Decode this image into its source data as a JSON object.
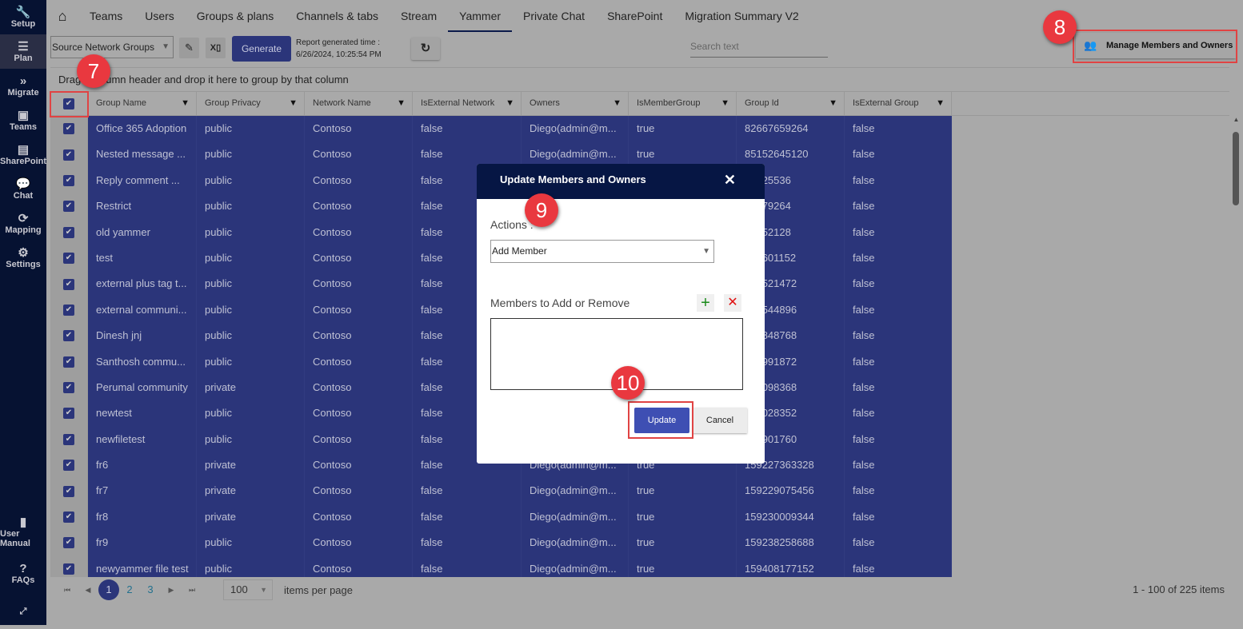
{
  "sidebar": {
    "items": [
      {
        "label": "Setup",
        "icon": "wrench-icon",
        "glyph": "🔧"
      },
      {
        "label": "Plan",
        "icon": "list-icon",
        "glyph": "☰",
        "active": true
      },
      {
        "label": "Migrate",
        "icon": "double-chevron-icon",
        "glyph": "»"
      },
      {
        "label": "Teams",
        "icon": "teams-icon",
        "glyph": "▣"
      },
      {
        "label": "SharePoint",
        "icon": "sharepoint-icon",
        "glyph": "▤"
      },
      {
        "label": "Chat",
        "icon": "chat-icon",
        "glyph": "💬"
      },
      {
        "label": "Mapping",
        "icon": "sync-icon",
        "glyph": "⟳"
      },
      {
        "label": "Settings",
        "icon": "gear-icon",
        "glyph": "⚙"
      }
    ],
    "bottom": [
      {
        "label": "User Manual",
        "icon": "book-icon",
        "glyph": "▮"
      },
      {
        "label": "FAQs",
        "icon": "question-icon",
        "glyph": "?"
      }
    ]
  },
  "tabs": [
    "Teams",
    "Users",
    "Groups & plans",
    "Channels & tabs",
    "Stream",
    "Yammer",
    "Private Chat",
    "SharePoint",
    "Migration Summary V2"
  ],
  "active_tab": "Yammer",
  "toolbar": {
    "report_select": "Source Network Groups",
    "generate": "Generate",
    "report_time_label": "Report generated time :",
    "report_time": "6/26/2024, 10:25:54 PM",
    "search_placeholder": "Search text",
    "manage": "Manage Members and Owners"
  },
  "group_bar": "Drag a column header and drop it here to group by that column",
  "columns": [
    "Group Name",
    "Group Privacy",
    "Network Name",
    "IsExternal Network",
    "Owners",
    "IsMemberGroup",
    "Group Id",
    "IsExternal Group"
  ],
  "rows": [
    [
      "Office 365 Adoption",
      "public",
      "Contoso",
      "false",
      "Diego(admin@m...",
      "true",
      "82667659264",
      "false"
    ],
    [
      "Nested message ...",
      "public",
      "Contoso",
      "false",
      "Diego(admin@m...",
      "true",
      "85152645120",
      "false"
    ],
    [
      "Reply comment ...",
      "public",
      "Contoso",
      "false",
      "",
      "",
      "40225536",
      "false"
    ],
    [
      "Restrict",
      "public",
      "Contoso",
      "false",
      "",
      "",
      "63179264",
      "false"
    ],
    [
      "old yammer",
      "public",
      "Contoso",
      "false",
      "",
      "",
      "64752128",
      "false"
    ],
    [
      "test",
      "public",
      "Contoso",
      "false",
      "",
      "",
      "183601152",
      "false"
    ],
    [
      "external plus tag t...",
      "public",
      "Contoso",
      "false",
      "",
      "",
      "988521472",
      "false"
    ],
    [
      "external communi...",
      "public",
      "Contoso",
      "false",
      "",
      "",
      "990544896",
      "false"
    ],
    [
      "Dinesh jnj",
      "public",
      "Contoso",
      "false",
      "",
      "",
      "938848768",
      "false"
    ],
    [
      "Santhosh commu...",
      "public",
      "Contoso",
      "false",
      "",
      "",
      "974991872",
      "false"
    ],
    [
      "Perumal community",
      "private",
      "Contoso",
      "false",
      "",
      "",
      "975098368",
      "false"
    ],
    [
      "newtest",
      "public",
      "Contoso",
      "false",
      "",
      "",
      "685028352",
      "false"
    ],
    [
      "newfiletest",
      "public",
      "Contoso",
      "false",
      "",
      "",
      "174901760",
      "false"
    ],
    [
      "fr6",
      "private",
      "Contoso",
      "false",
      "Diego(admin@m...",
      "true",
      "159227363328",
      "false"
    ],
    [
      "fr7",
      "private",
      "Contoso",
      "false",
      "Diego(admin@m...",
      "true",
      "159229075456",
      "false"
    ],
    [
      "fr8",
      "private",
      "Contoso",
      "false",
      "Diego(admin@m...",
      "true",
      "159230009344",
      "false"
    ],
    [
      "fr9",
      "public",
      "Contoso",
      "false",
      "Diego(admin@m...",
      "true",
      "159238258688",
      "false"
    ],
    [
      "newyammer file test",
      "public",
      "Contoso",
      "false",
      "Diego(admin@m...",
      "true",
      "159408177152",
      "false"
    ]
  ],
  "pager": {
    "pages": [
      "1",
      "2",
      "3"
    ],
    "current": "1",
    "page_size": "100",
    "items_per_page": "items per page",
    "count": "1 - 100 of 225 items"
  },
  "modal": {
    "title": "Update Members and Owners",
    "actions_label": "Actions :",
    "action_value": "Add Member",
    "members_label": "Members to Add or Remove",
    "update": "Update",
    "cancel": "Cancel"
  },
  "badges": [
    "7",
    "8",
    "9",
    "10"
  ],
  "colors": {
    "sidebar": "#061232",
    "selection": "#2b357a",
    "modal_header": "#061644",
    "update": "#3e4fb3",
    "highlight": "#e04343"
  }
}
